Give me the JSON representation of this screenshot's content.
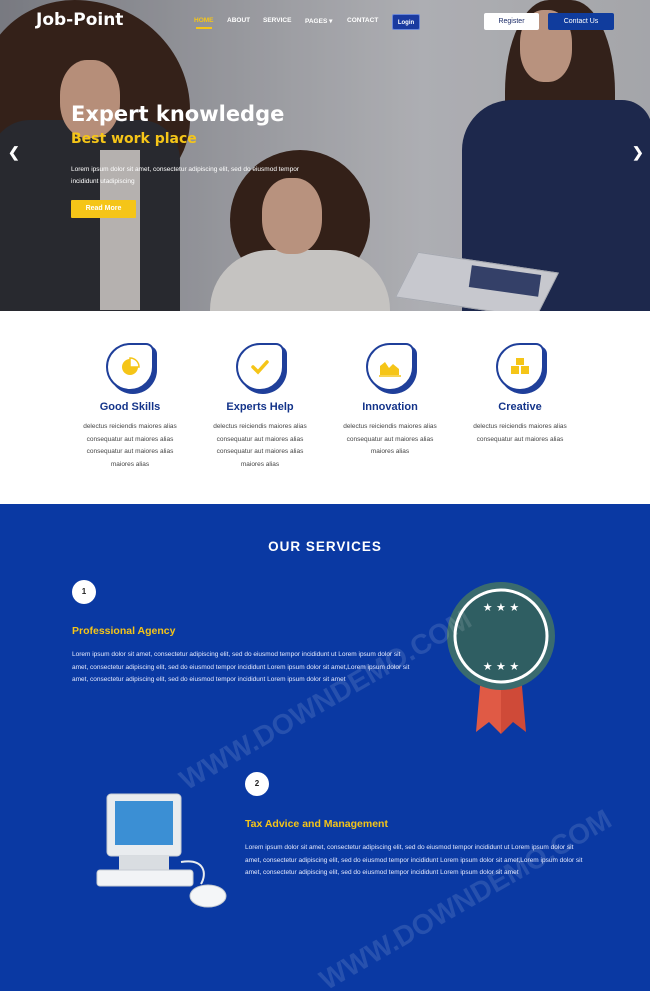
{
  "brand": {
    "logo": "Job-Point",
    "accent": "#f5c518",
    "primary": "#0a39a3"
  },
  "nav": {
    "items": [
      {
        "label": "HOME",
        "active": true
      },
      {
        "label": "ABOUT"
      },
      {
        "label": "SERVICE"
      },
      {
        "label": "PAGES ▾"
      },
      {
        "label": "CONTACT"
      }
    ],
    "login": "Login",
    "register": "Register",
    "contact": "Contact Us"
  },
  "hero": {
    "title": "Expert knowledge",
    "subtitle": "Best work place",
    "text": "Lorem ipsum dolor sit amet, consectetur adipiscing elit, sed do eiusmod tempor incididunt utadipiscing",
    "button": "Read More",
    "prev_icon": "chevron-left-icon",
    "next_icon": "chevron-right-icon"
  },
  "features": [
    {
      "title": "Good Skills",
      "icon": "pie-chart-icon",
      "text": "delectus reiciendis maiores alias consequatur aut maiores alias consequatur aut maiores alias maiores alias"
    },
    {
      "title": "Experts Help",
      "icon": "checkmark-icon",
      "text": "delectus reiciendis maiores alias consequatur aut maiores alias consequatur aut maiores alias maiores alias"
    },
    {
      "title": "Innovation",
      "icon": "area-chart-icon",
      "text": "delectus reiciendis maiores alias consequatur aut maiores alias maiores alias"
    },
    {
      "title": "Creative",
      "icon": "boxes-icon",
      "text": "delectus reiciendis maiores alias consequatur aut maiores alias"
    }
  ],
  "services": {
    "title": "OUR SERVICES",
    "items": [
      {
        "number": "1",
        "title": "Professional Agency",
        "text": "Lorem ipsum dolor sit amet, consectetur adipiscing elit, sed do eiusmod tempor incididunt ut Lorem ipsum dolor sit amet, consectetur adipiscing elit, sed do eiusmod tempor incididunt Lorem ipsum dolor sit amet,Lorem ipsum dolor sit amet, consectetur adipiscing elit, sed do eiusmod tempor incididunt Lorem ipsum dolor sit amet"
      },
      {
        "number": "2",
        "title": "Tax Advice and Management",
        "text": "Lorem ipsum dolor sit amet, consectetur adipiscing elit, sed do eiusmod tempor incididunt ut Lorem ipsum dolor sit amet, consectetur adipiscing elit, sed do eiusmod tempor incididunt Lorem ipsum dolor sit amet,Lorem ipsum dolor sit amet, consectetur adipiscing elit, sed do eiusmod tempor incididunt Lorem ipsum dolor sit amet"
      }
    ]
  },
  "watermark": "WWW.DOWNDEMO.COM"
}
